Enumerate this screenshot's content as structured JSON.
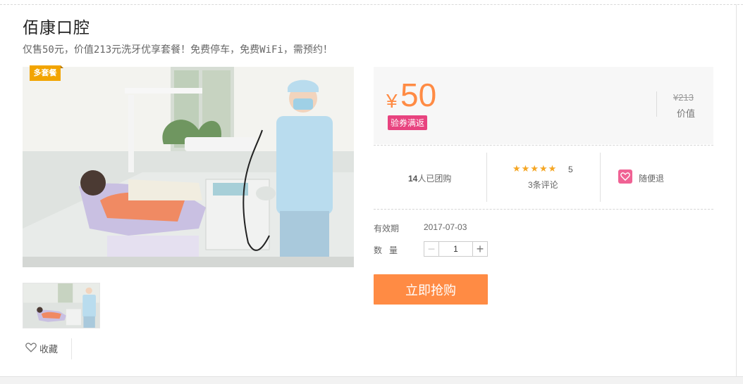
{
  "deal": {
    "title": "佰康口腔",
    "subtitle": "仅售50元，价值213元洗牙优享套餐！免费停车，免费WiFi，需预约！",
    "ribbon": "多套餐"
  },
  "gallery": {
    "main_image": "dental-clinic-photo",
    "thumbnails": [
      "dental-clinic-photo"
    ]
  },
  "favorite": {
    "label": "收藏",
    "icon": "heart-outline-icon"
  },
  "price": {
    "currency": "¥",
    "current": "50",
    "badge": "验券满返",
    "original": "¥213",
    "original_label": "价值"
  },
  "stats": {
    "sold_count": "14",
    "sold_suffix": "人已团购",
    "rating_stars": 5,
    "rating_score": "5",
    "reviews": "3条评论",
    "refund_label": "随便退",
    "refund_icon": "heart-badge-icon"
  },
  "purchase": {
    "validity_label": "有效期",
    "validity_date": "2017-07-03",
    "quantity_label": "数量",
    "quantity_value": "1",
    "minus_label": "−",
    "plus_label": "+",
    "buy_label": "立即抢购"
  },
  "colors": {
    "accent": "#ff8b44",
    "badge": "#e8437f",
    "ribbon": "#f2a400",
    "star": "#f5a623"
  }
}
